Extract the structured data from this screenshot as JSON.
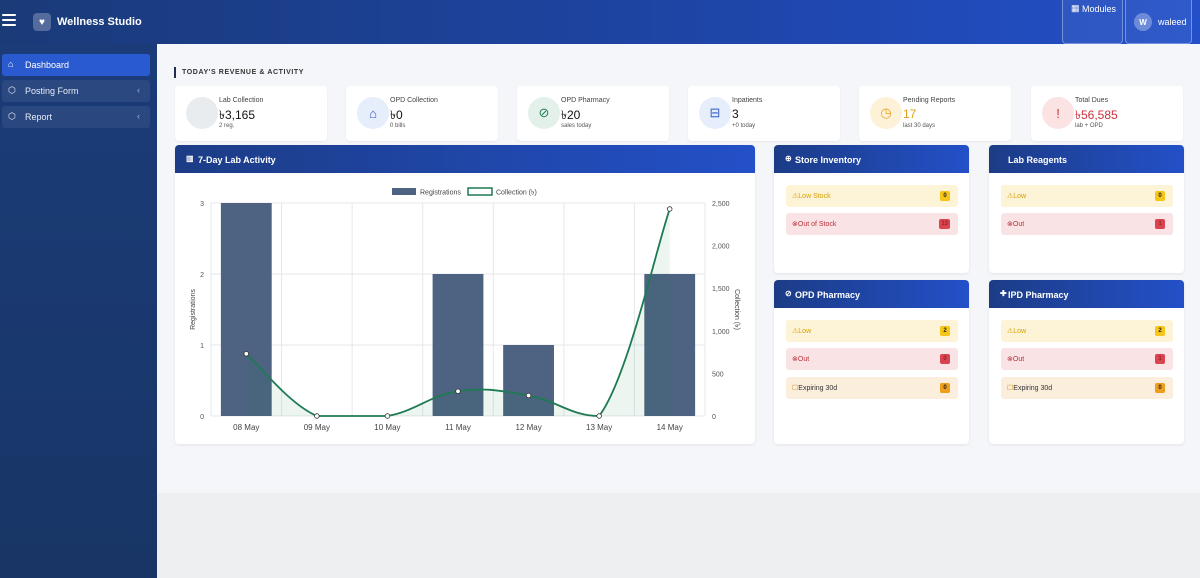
{
  "app": {
    "title": "Wellness Studio"
  },
  "topbar": {
    "modules_label": "Modules",
    "user_initial": "W",
    "user_name": "waleed"
  },
  "sidebar": {
    "items": [
      {
        "label": "Dashboard",
        "icon": "home-icon",
        "active": true
      },
      {
        "label": "Posting Form",
        "icon": "cube-icon",
        "expandable": true
      },
      {
        "label": "Report",
        "icon": "cube-icon",
        "expandable": true
      }
    ]
  },
  "section_title": "TODAY'S REVENUE & ACTIVITY",
  "stats": [
    {
      "label": "Lab Collection",
      "value": "৳3,165",
      "sub": "2 reg.",
      "icon": "flask-icon",
      "icon_bg": "#e9ecef",
      "icon_color": "#adb5bd",
      "value_color": "#111111"
    },
    {
      "label": "OPD Collection",
      "value": "৳0",
      "sub": "0 bills",
      "icon": "house-medical-icon",
      "icon_bg": "#e6edfb",
      "icon_color": "#2f5cc7",
      "value_color": "#111111"
    },
    {
      "label": "OPD Pharmacy",
      "value": "৳20",
      "sub": "sales today",
      "icon": "pill-icon",
      "icon_bg": "#e4f1ea",
      "icon_color": "#1e8050",
      "value_color": "#111111"
    },
    {
      "label": "Inpatients",
      "value": "3",
      "sub": "+0 today",
      "icon": "bed-icon",
      "icon_bg": "#e6edfb",
      "icon_color": "#2f5cc7",
      "value_color": "#111111"
    },
    {
      "label": "Pending Reports",
      "value": "17",
      "sub": "last 30 days",
      "icon": "clock-icon",
      "icon_bg": "#fdf1d8",
      "icon_color": "#e8a319",
      "value_color": "#e0a11a"
    },
    {
      "label": "Total Dues",
      "value": "৳56,585",
      "sub": "lab + OPD",
      "icon": "alert-icon",
      "icon_bg": "#fbe3e4",
      "icon_color": "#d0343f",
      "value_color": "#c9333d"
    }
  ],
  "chart_card": {
    "title": "7-Day Lab Activity"
  },
  "chart_data": {
    "type": "bar",
    "categories": [
      "08 May",
      "09 May",
      "10 May",
      "11 May",
      "12 May",
      "13 May",
      "14 May"
    ],
    "series": [
      {
        "name": "Registrations",
        "type": "bar",
        "axis": "left",
        "values": [
          3,
          0,
          0,
          2,
          1,
          0,
          2
        ],
        "color": "#4e6282"
      },
      {
        "name": "Collection (৳)",
        "type": "line",
        "axis": "right",
        "values": [
          730,
          0,
          0,
          290,
          240,
          0,
          2430
        ],
        "color": "#1e7a52"
      }
    ],
    "ylabel": "Registrations",
    "y2label": "Collection (৳)",
    "ylim": [
      0,
      3
    ],
    "y2lim": [
      0,
      2500
    ],
    "yticks": [
      0,
      1,
      2,
      3
    ],
    "y2ticks": [
      0,
      500,
      1000,
      1500,
      2000,
      2500
    ],
    "y2ticklabels": [
      "0",
      "500",
      "1,000",
      "1,500",
      "2,000",
      "2,500"
    ],
    "grid": true,
    "legend": "top-center"
  },
  "inventory": {
    "store": {
      "title": "Store Inventory",
      "rows": [
        {
          "label": "Low Stock",
          "count": "0",
          "kind": "low"
        },
        {
          "label": "Out of Stock",
          "count": "13",
          "kind": "out"
        }
      ]
    },
    "lab_reagents": {
      "title": "Lab Reagents",
      "rows": [
        {
          "label": "Low",
          "count": "0",
          "kind": "low"
        },
        {
          "label": "Out",
          "count": "1",
          "kind": "out"
        }
      ]
    },
    "opd_pharmacy": {
      "title": "OPD Pharmacy",
      "rows": [
        {
          "label": "Low",
          "count": "2",
          "kind": "low"
        },
        {
          "label": "Out",
          "count": "0",
          "kind": "out"
        },
        {
          "label": "Expiring 30d",
          "count": "0",
          "kind": "exp"
        }
      ]
    },
    "ipd_pharmacy": {
      "title": "IPD Pharmacy",
      "rows": [
        {
          "label": "Low",
          "count": "2",
          "kind": "low"
        },
        {
          "label": "Out",
          "count": "1",
          "kind": "out"
        },
        {
          "label": "Expiring 30d",
          "count": "0",
          "kind": "exp"
        }
      ]
    }
  }
}
